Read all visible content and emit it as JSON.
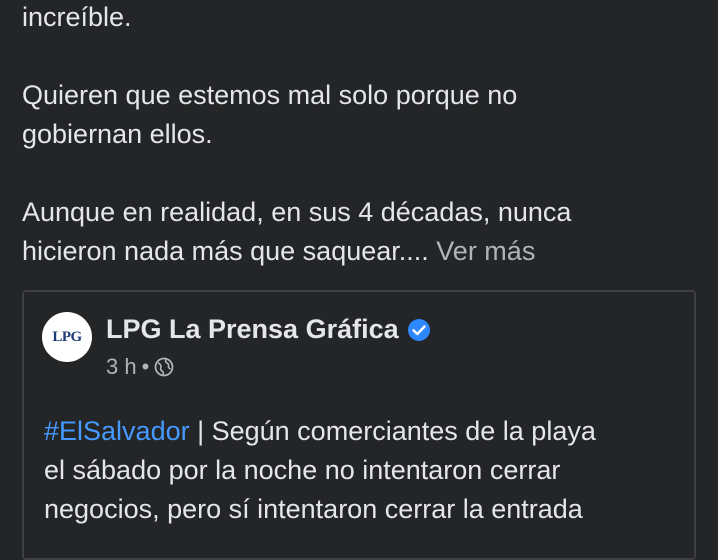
{
  "post": {
    "lines": [
      "increíble.",
      "",
      "Quieren que estemos mal solo porque no",
      "gobiernan ellos.",
      "",
      "Aunque en realidad, en sus 4 décadas, nunca",
      "hicieron nada más que saquear.... "
    ],
    "see_more_label": "Ver más"
  },
  "shared_post": {
    "avatar_text": "LPG",
    "page_name": "LPG La Prensa Gráfica",
    "verified_icon": "verified-badge-icon",
    "time": "3 h",
    "separator": "•",
    "audience_icon": "globe-icon",
    "hashtag": "#ElSalvador",
    "text_line1_rest": " | Según comerciantes de la playa",
    "text_line2": "el sábado por la noche no intentaron cerrar",
    "text_line3": "negocios, pero sí intentaron cerrar la entrada"
  },
  "colors": {
    "background": "#242526",
    "text": "#e4e6eb",
    "secondary_text": "#b0b3b8",
    "link": "#4599ff",
    "verified": "#2d88ff"
  }
}
